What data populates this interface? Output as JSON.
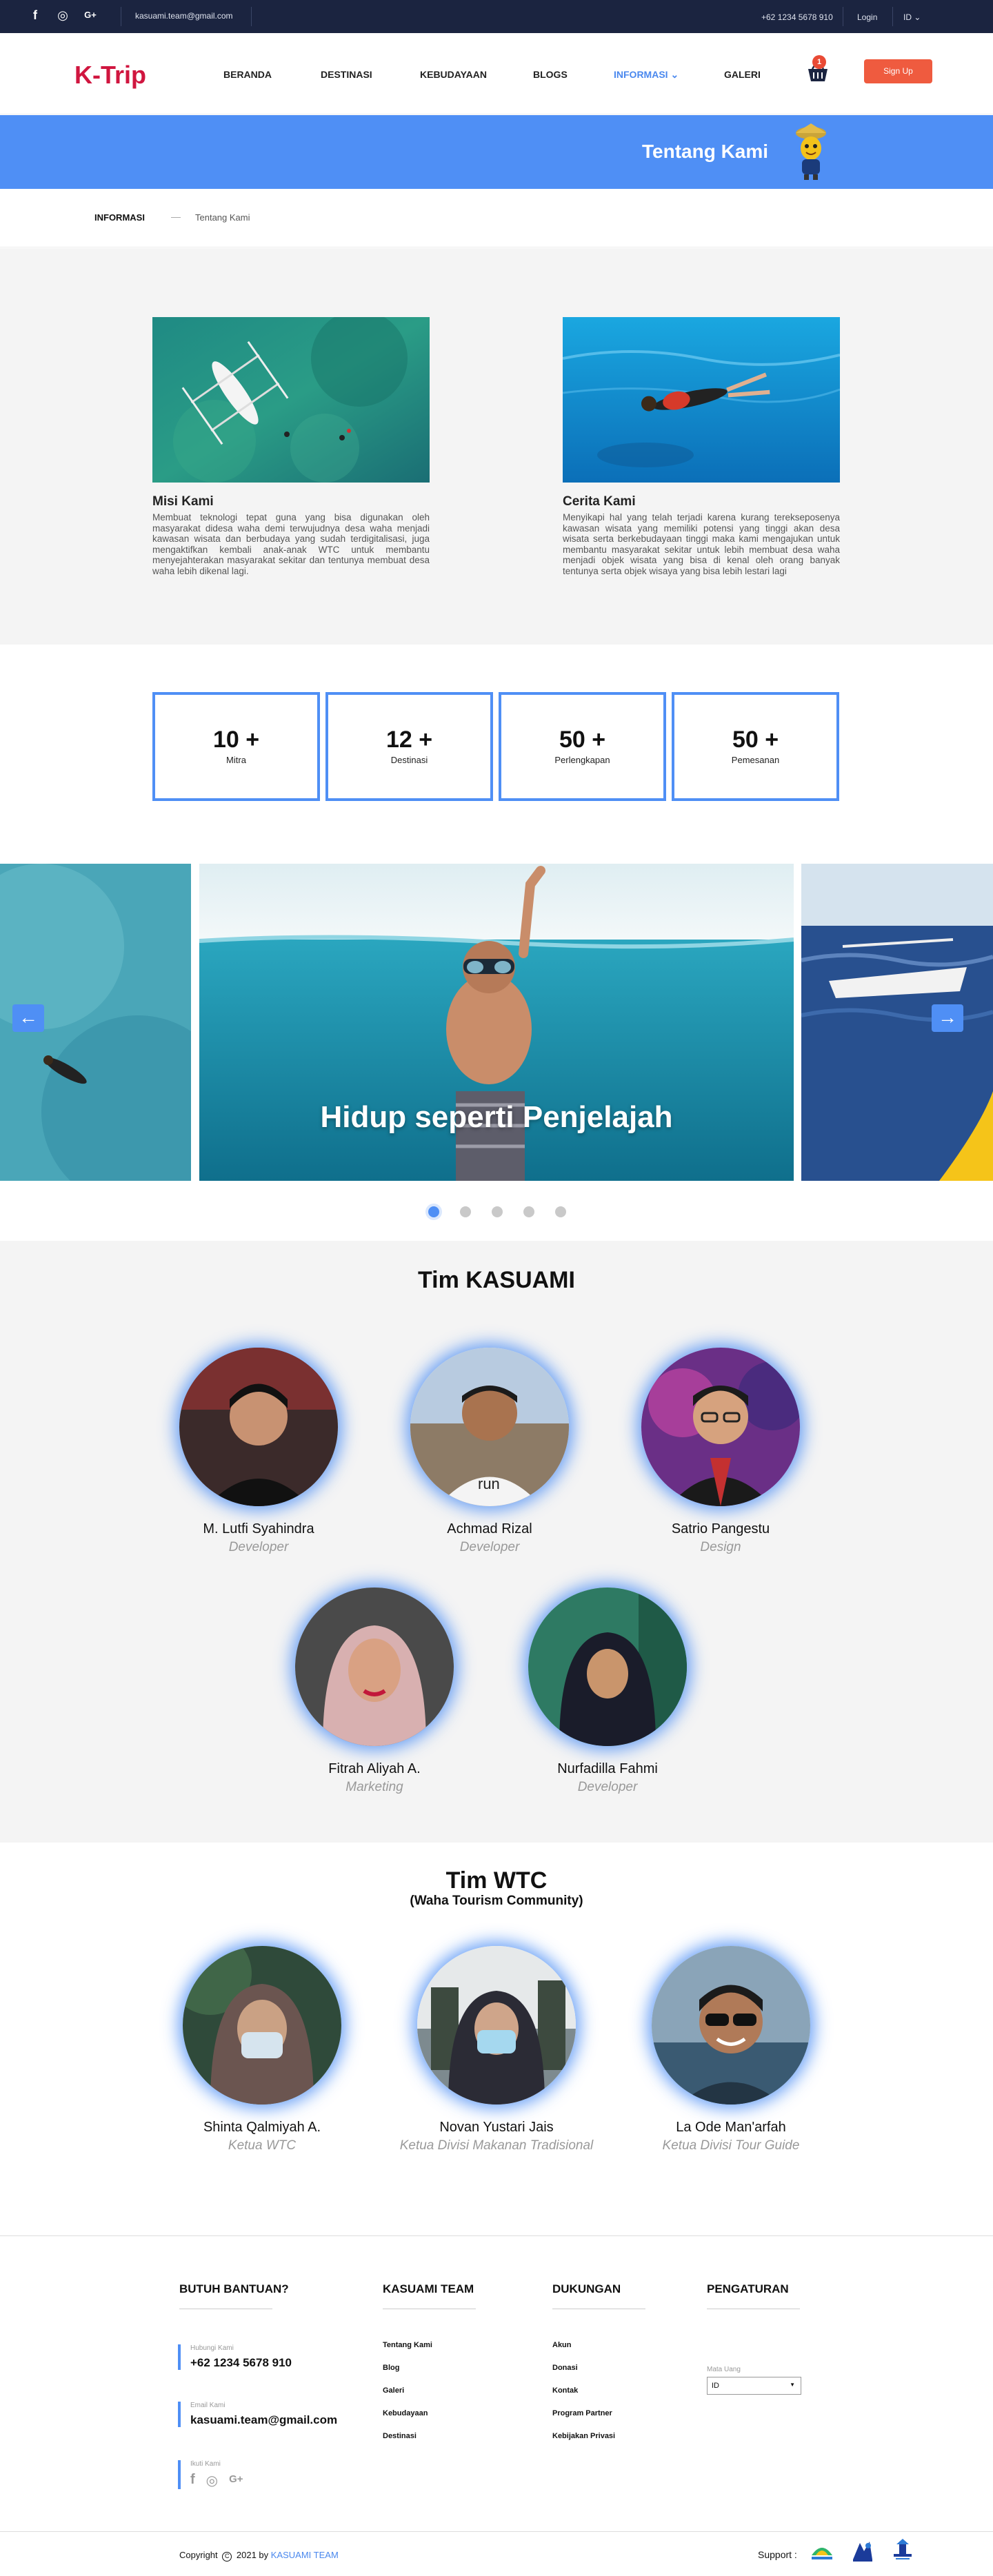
{
  "topbar": {
    "social_icons": [
      "facebook-icon",
      "instagram-icon",
      "google-plus-icon"
    ],
    "social_glyphs": [
      "f",
      "◎",
      "G+"
    ],
    "email": "kasuami.team@gmail.com",
    "phone": "+62 1234 5678 910",
    "login": "Login",
    "language": "ID ⌄"
  },
  "nav": {
    "logo": "K-Trip",
    "items": [
      {
        "label": "BERANDA"
      },
      {
        "label": "DESTINASI"
      },
      {
        "label": "KEBUDAYAAN"
      },
      {
        "label": "BLOGS"
      },
      {
        "label": "INFORMASI ⌄"
      },
      {
        "label": "GALERI"
      }
    ],
    "cart_count": "1",
    "signup": "Sign Up"
  },
  "banner": {
    "title": "Tentang Kami"
  },
  "breadcrumb": {
    "section": "INFORMASI",
    "page": "Tentang Kami"
  },
  "about": {
    "cards": [
      {
        "title": "Misi Kami",
        "text": "Membuat teknologi tepat guna yang bisa digunakan oleh masyarakat didesa waha demi terwujudnya desa waha menjadi kawasan wisata dan berbudaya yang sudah terdigitalisasi, juga mengaktifkan kembali anak-anak WTC untuk membantu menyejahterakan masyarakat sekitar dan tentunya membuat desa waha lebih dikenal lagi."
      },
      {
        "title": "Cerita Kami",
        "text": "Menyikapi hal yang telah terjadi karena kurang terekseposenya kawasan wisata yang memiliki potensi yang tinggi akan desa wisata serta berkebudayaan tinggi maka kami mengajukan untuk membantu masyarakat sekitar untuk lebih membuat desa waha menjadi objek wisata yang bisa di kenal oleh orang banyak tentunya serta objek wisaya yang bisa lebih lestari lagi"
      }
    ]
  },
  "stats": [
    {
      "value": "10 +",
      "label": "Mitra"
    },
    {
      "value": "12 +",
      "label": "Destinasi"
    },
    {
      "value": "50 +",
      "label": "Perlengkapan"
    },
    {
      "value": "50 +",
      "label": "Pemesanan"
    }
  ],
  "carousel": {
    "caption": "Hidup seperti Penjelajah",
    "prev": "←",
    "next": "→",
    "dot_count": 5,
    "active_index": 0
  },
  "team_kasuami": {
    "title": "Tim KASUAMI",
    "members": [
      {
        "name": "M. Lutfi Syahindra",
        "role": "Developer"
      },
      {
        "name": "Achmad Rizal",
        "role": "Developer"
      },
      {
        "name": "Satrio Pangestu",
        "role": "Design"
      },
      {
        "name": "Fitrah Aliyah A.",
        "role": "Marketing"
      },
      {
        "name": "Nurfadilla Fahmi",
        "role": "Developer"
      }
    ]
  },
  "team_wtc": {
    "title": "Tim WTC",
    "subtitle": "(Waha Tourism Community)",
    "members": [
      {
        "name": "Shinta Qalmiyah A.",
        "role": "Ketua WTC"
      },
      {
        "name": "Novan Yustari Jais",
        "role": "Ketua Divisi Makanan Tradisional"
      },
      {
        "name": "La Ode Man'arfah",
        "role": "Ketua Divisi Tour Guide"
      }
    ]
  },
  "footer": {
    "help": {
      "title": "BUTUH BANTUAN?",
      "phone_label": "Hubungi Kami",
      "phone": "+62 1234 5678 910",
      "email_label": "Email Kami",
      "email": "kasuami.team@gmail.com",
      "social_label": "Ikuti Kami"
    },
    "team": {
      "title": "KASUAMI TEAM",
      "links": [
        "Tentang Kami",
        "Blog",
        "Galeri",
        "Kebudayaan",
        "Destinasi"
      ]
    },
    "support": {
      "title": "DUKUNGAN",
      "links": [
        "Akun",
        "Donasi",
        "Kontak",
        "Program Partner",
        "Kebijakan Privasi"
      ]
    },
    "settings": {
      "title": "PENGATURAN",
      "currency_label": "Mata Uang",
      "currency_value": "ID"
    },
    "copyright_prefix": "Copyright",
    "copyright_year": "2021 by",
    "copyright_team": "KASUAMI TEAM",
    "support_label": "Support :",
    "support_logos": [
      "kasuami-logo",
      "merdeka-logo",
      "pesona-indonesia-logo"
    ]
  },
  "colors": {
    "primary": "#4f8ff5",
    "brand_red": "#d0163f",
    "signup": "#ef5b3f",
    "topbar": "#1b2440"
  }
}
